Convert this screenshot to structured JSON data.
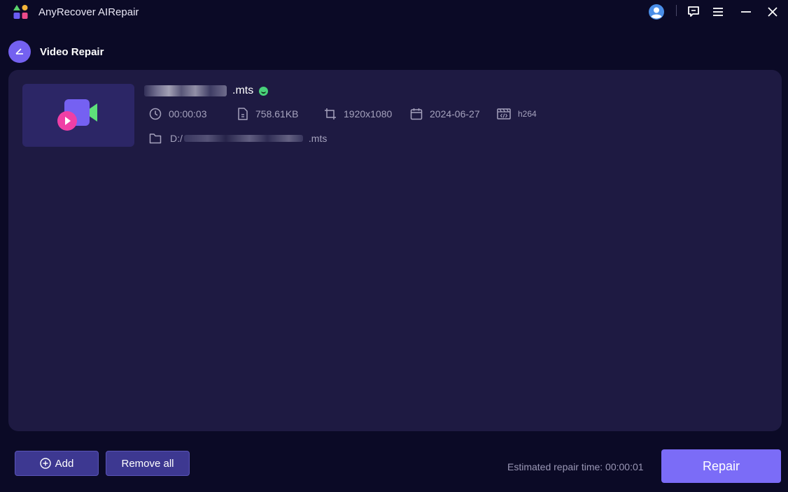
{
  "app": {
    "title": "AnyRecover AIRepair"
  },
  "header": {
    "page_title": "Video Repair"
  },
  "file": {
    "name_suffix": ".mts",
    "status": "ok",
    "duration": "00:00:03",
    "size": "758.61KB",
    "resolution": "1920x1080",
    "date": "2024-06-27",
    "codec": "h264",
    "path_prefix": "D:/",
    "path_suffix": ".mts"
  },
  "footer": {
    "add_label": "Add",
    "remove_all_label": "Remove all",
    "estimated_time": "Estimated repair time: 00:00:01",
    "repair_label": "Repair"
  },
  "colors": {
    "background": "#0b0a26",
    "panel": "#1e1a42",
    "accent": "#7b6cf7",
    "secondary_button": "#3d3891",
    "status_ok": "#48d17a"
  },
  "icons": {
    "titlebar": [
      "app-logo-icon",
      "user-avatar-icon",
      "feedback-icon",
      "menu-icon",
      "minimize-icon",
      "close-icon"
    ],
    "meta": [
      "clock-icon",
      "file-icon",
      "crop-icon",
      "calendar-icon",
      "codec-icon",
      "folder-icon"
    ]
  }
}
